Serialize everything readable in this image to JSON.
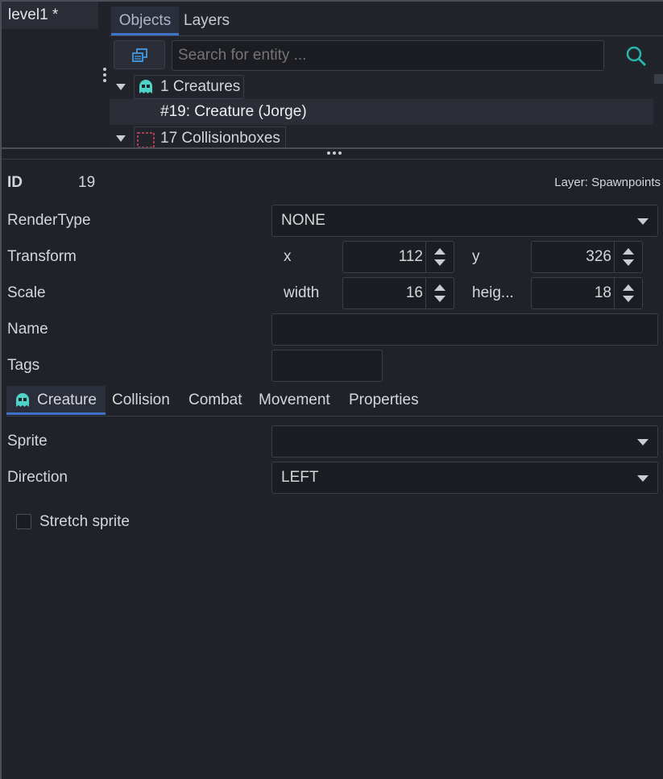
{
  "left_panel": {
    "level_title": "level1 *"
  },
  "top_tabs": {
    "objects": "Objects",
    "layers": "Layers"
  },
  "search": {
    "placeholder": "Search for entity ..."
  },
  "tree": {
    "group_creatures": "1 Creatures",
    "item_selected": "#19: Creature (Jorge)",
    "group_collision": "17 Collisionboxes"
  },
  "props": {
    "id_label": "ID",
    "id_value": "19",
    "layer_text": "Layer: Spawnpoints",
    "rendertype_label": "RenderType",
    "rendertype_value": "NONE",
    "transform_label": "Transform",
    "x_label": "x",
    "x_value": "112",
    "y_label": "y",
    "y_value": "326",
    "scale_label": "Scale",
    "width_label": "width",
    "width_value": "16",
    "height_label": "heig...",
    "height_value": "18",
    "name_label": "Name",
    "name_value": "",
    "tags_label": "Tags"
  },
  "bottom_tabs": {
    "creature": "Creature",
    "collision": "Collision",
    "combat": "Combat",
    "movement": "Movement",
    "properties": "Properties"
  },
  "creature_props": {
    "sprite_label": "Sprite",
    "sprite_value": "",
    "direction_label": "Direction",
    "direction_value": "LEFT",
    "stretch_label": "Stretch sprite",
    "stretch_checked": false
  },
  "colors": {
    "accent": "#3f73c9",
    "creature_icon": "#4fd1c5",
    "collision_icon": "#d9475c"
  }
}
